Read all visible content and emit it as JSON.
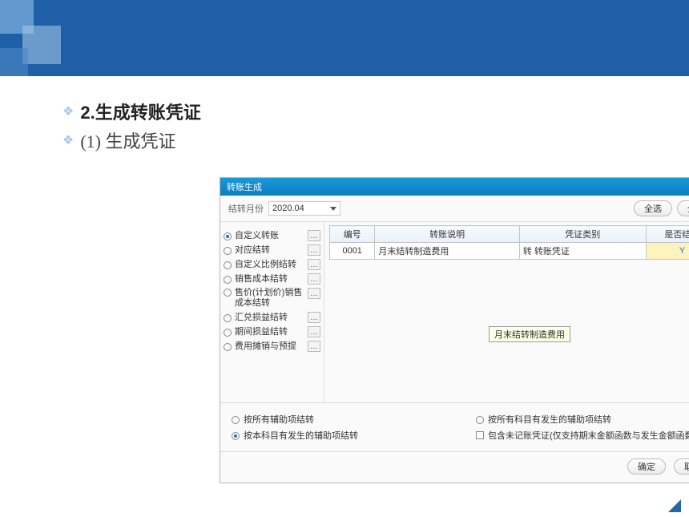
{
  "headings": {
    "h1": "2.生成转账凭证",
    "h2": "(1) 生成凭证"
  },
  "dialog": {
    "title": "转账生成",
    "month_label": "结转月份",
    "month_value": "2020.04",
    "btn_all": "全选",
    "btn_none": "全消",
    "sidebar": {
      "items": [
        "自定义转账",
        "对应结转",
        "自定义比例结转",
        "销售成本结转",
        "售价(计划价)销售成本结转",
        "汇兑损益结转",
        "期间损益结转",
        "费用摊销与预提"
      ]
    },
    "grid": {
      "headers": [
        "编号",
        "转账说明",
        "凭证类别",
        "是否结转"
      ],
      "row": {
        "id": "0001",
        "desc": "月末结转制造费用",
        "type": "转 转账凭证",
        "yes": "Y"
      }
    },
    "tooltip": "月末结转制造费用",
    "options": {
      "left1": "按所有辅助项结转",
      "left2": "按本科目有发生的辅助项结转",
      "right1": "按所有科目有发生的辅助项结转",
      "right2": "包含未记账凭证(仅支持期末金额函数与发生金额函数)"
    },
    "btn_ok": "确定",
    "btn_cancel": "取消"
  }
}
